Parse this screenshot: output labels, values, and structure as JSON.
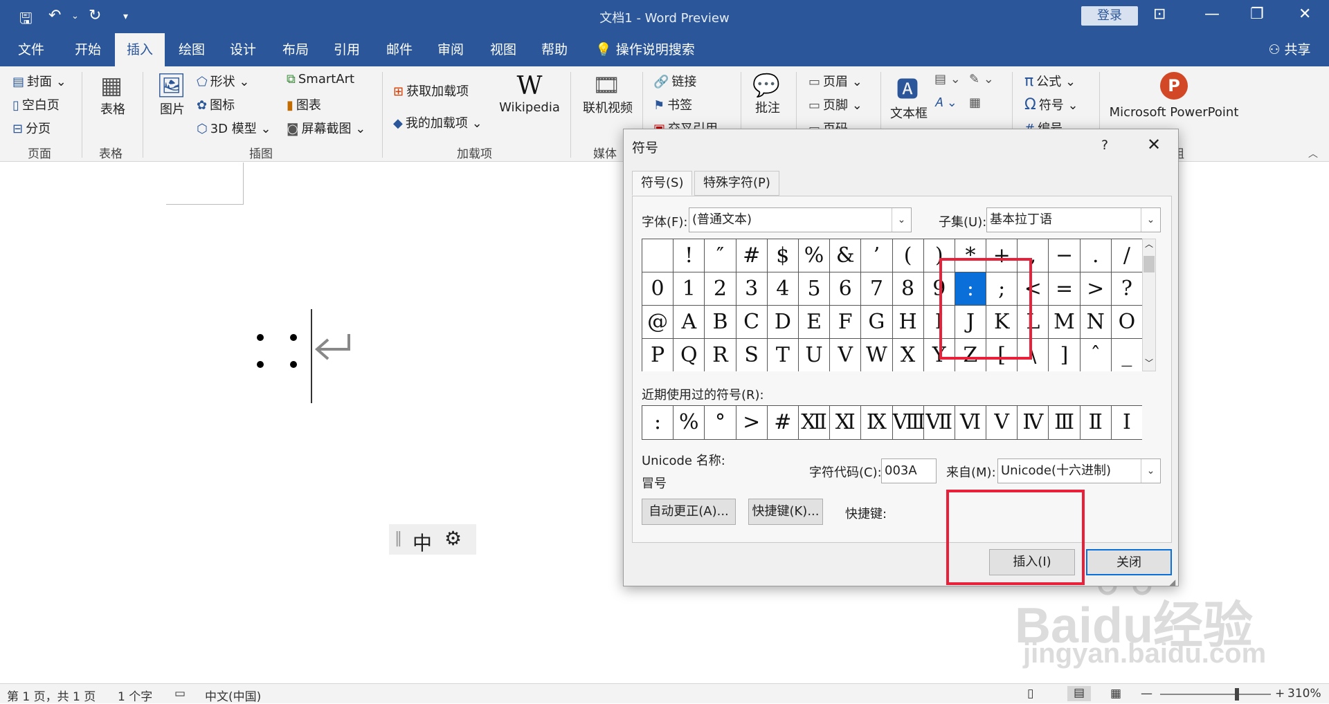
{
  "titlebar": {
    "title": "文档1  -  Word Preview",
    "login": "登录"
  },
  "tabs": [
    "文件",
    "开始",
    "插入",
    "绘图",
    "设计",
    "布局",
    "引用",
    "邮件",
    "审阅",
    "视图",
    "帮助"
  ],
  "tell_me": "操作说明搜索",
  "share": "共享",
  "ribbon": {
    "pages": [
      "封面",
      "空白页",
      "分页"
    ],
    "pages_label": "页面",
    "table": "表格",
    "table_label": "表格",
    "picture": "图片",
    "shapes": "形状",
    "icons": "图标",
    "model3d": "3D 模型",
    "smartart": "SmartArt",
    "chart": "图表",
    "screenshot": "屏幕截图",
    "illustrations_label": "插图",
    "get_addins": "获取加载项",
    "my_addins": "我的加载项",
    "wikipedia": "Wikipedia",
    "addins_label": "加载项",
    "online_video": "联机视频",
    "media_label": "媒体",
    "link": "链接",
    "bookmark": "书签",
    "crossref": "交叉引用",
    "comment": "批注",
    "header": "页眉",
    "footer": "页脚",
    "pagenum": "页码",
    "textbox": "文本框",
    "equation": "公式",
    "symbol": "符号",
    "number": "编号",
    "powerpoint": "Microsoft PowerPoint",
    "group_suffix": "组"
  },
  "document": {
    "content": "： ",
    "ime_text": "中"
  },
  "dialog": {
    "title": "符号",
    "help": "?",
    "tab_symbols": "符号(S)",
    "tab_special": "特殊字符(P)",
    "font_label": "字体(F):",
    "font_value": "(普通文本)",
    "subset_label": "子集(U):",
    "subset_value": "基本拉丁语",
    "grid": [
      [
        " ",
        "!",
        "″",
        "#",
        "$",
        "%",
        "&",
        "’",
        "(",
        ")",
        "*",
        "+",
        ",",
        "−",
        ".",
        "/"
      ],
      [
        "0",
        "1",
        "2",
        "3",
        "4",
        "5",
        "6",
        "7",
        "8",
        "9",
        ":",
        ";",
        "<",
        "=",
        ">",
        "?"
      ],
      [
        "@",
        "A",
        "B",
        "C",
        "D",
        "E",
        "F",
        "G",
        "H",
        "I",
        "J",
        "K",
        "L",
        "M",
        "N",
        "O"
      ],
      [
        "P",
        "Q",
        "R",
        "S",
        "T",
        "U",
        "V",
        "W",
        "X",
        "Y",
        "Z",
        "[",
        "\\",
        "]",
        "ˆ",
        "_"
      ]
    ],
    "recent_label": "近期使用过的符号(R):",
    "recent": [
      ":",
      "%",
      "°",
      ">",
      "#",
      "Ⅻ",
      "Ⅺ",
      "Ⅸ",
      "Ⅷ",
      "Ⅶ",
      "Ⅵ",
      "Ⅴ",
      "Ⅳ",
      "Ⅲ",
      "Ⅱ",
      "Ⅰ"
    ],
    "unicode_name_label": "Unicode 名称:",
    "unicode_name_value": "冒号",
    "charcode_label": "字符代码(C):",
    "charcode_value": "003A",
    "from_label": "来自(M):",
    "from_value": "Unicode(十六进制)",
    "autocorrect": "自动更正(A)...",
    "shortcut_key_btn": "快捷键(K)...",
    "shortcut_label": "快捷键:",
    "insert": "插入(I)",
    "close": "关闭"
  },
  "statusbar": {
    "page": "第 1 页，共 1 页",
    "words": "1 个字",
    "lang": "中文(中国)",
    "zoom": "310%"
  },
  "watermark": {
    "brand": "Baidu经验",
    "url": "jingyan.baidu.com"
  }
}
